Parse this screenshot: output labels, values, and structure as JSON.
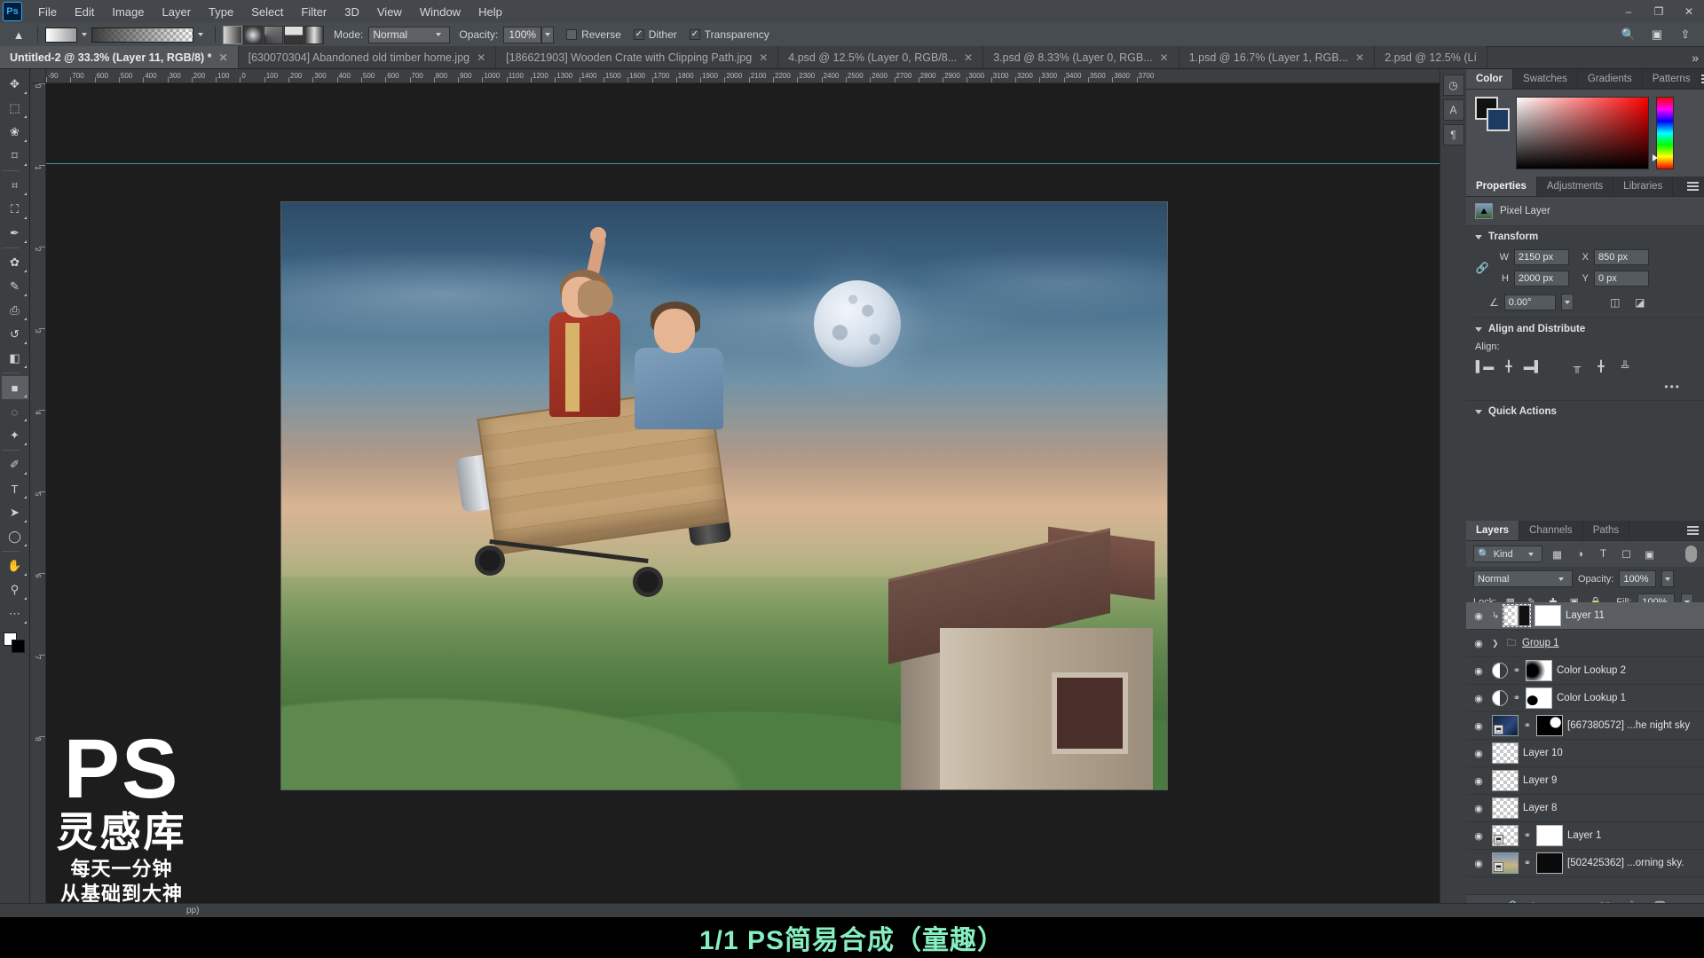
{
  "app": {
    "logo": "Ps"
  },
  "menubar": {
    "items": [
      "File",
      "Edit",
      "Image",
      "Layer",
      "Type",
      "Select",
      "Filter",
      "3D",
      "View",
      "Window",
      "Help"
    ],
    "window_controls": {
      "minimize": "–",
      "maximize": "❐",
      "close": "✕"
    }
  },
  "options_bar": {
    "home_icon": "home-icon",
    "gradient_preset_label": "gradient-preset",
    "gradient_types": [
      "linear-gradient",
      "radial-gradient",
      "angle-gradient",
      "reflected-gradient",
      "diamond-gradient"
    ],
    "mode_label": "Mode:",
    "mode_value": "Normal",
    "opacity_label": "Opacity:",
    "opacity_value": "100%",
    "reverse_label": "Reverse",
    "reverse_checked": false,
    "dither_label": "Dither",
    "dither_checked": true,
    "transparency_label": "Transparency",
    "transparency_checked": true,
    "right_icons": [
      "search-icon",
      "workspace-icon",
      "share-icon"
    ]
  },
  "tabs": [
    {
      "label": "Untitled-2 @ 33.3% (Layer 11, RGB/8) *",
      "active": true,
      "close": "✕"
    },
    {
      "label": "[630070304] Abandoned old timber home.jpg",
      "active": false,
      "close": "✕"
    },
    {
      "label": "[186621903] Wooden Crate with Clipping Path.jpg",
      "active": false,
      "close": "✕"
    },
    {
      "label": "4.psd @ 12.5% (Layer 0, RGB/8...",
      "active": false,
      "close": "✕"
    },
    {
      "label": "3.psd @ 8.33% (Layer 0, RGB...",
      "active": false,
      "close": "✕"
    },
    {
      "label": "1.psd @ 16.7% (Layer 1, RGB...",
      "active": false,
      "close": "✕"
    },
    {
      "label": "2.psd @ 12.5% (Lí",
      "active": false,
      "close": ""
    }
  ],
  "tabs_overflow": "»",
  "toolbar": {
    "tools": [
      {
        "name": "move-tool",
        "glyph": "✥",
        "selected": false
      },
      {
        "name": "rectangular-marquee-tool",
        "glyph": "⬚",
        "selected": false
      },
      {
        "name": "lasso-tool",
        "glyph": "❀",
        "selected": false
      },
      {
        "name": "object-selection-tool",
        "glyph": "⌑",
        "selected": false
      },
      {
        "name": "crop-tool",
        "glyph": "⌗",
        "selected": false
      },
      {
        "name": "frame-tool",
        "glyph": "⛶",
        "selected": false
      },
      {
        "name": "eyedropper-tool",
        "glyph": "✒",
        "selected": false
      },
      {
        "name": "spot-healing-brush-tool",
        "glyph": "✿",
        "selected": false
      },
      {
        "name": "brush-tool",
        "glyph": "✎",
        "selected": false
      },
      {
        "name": "clone-stamp-tool",
        "glyph": "⎙",
        "selected": false
      },
      {
        "name": "history-brush-tool",
        "glyph": "↺",
        "selected": false
      },
      {
        "name": "eraser-tool",
        "glyph": "◧",
        "selected": false
      },
      {
        "name": "gradient-tool",
        "glyph": "■",
        "selected": true
      },
      {
        "name": "blur-tool",
        "glyph": "◌",
        "selected": false
      },
      {
        "name": "dodge-tool",
        "glyph": "✦",
        "selected": false
      },
      {
        "name": "pen-tool",
        "glyph": "✐",
        "selected": false
      },
      {
        "name": "horizontal-type-tool",
        "glyph": "T",
        "selected": false
      },
      {
        "name": "path-selection-tool",
        "glyph": "➤",
        "selected": false
      },
      {
        "name": "ellipse-tool",
        "glyph": "◯",
        "selected": false
      },
      {
        "name": "hand-tool",
        "glyph": "✋",
        "selected": false
      },
      {
        "name": "zoom-tool",
        "glyph": "⚲",
        "selected": false
      },
      {
        "name": "edit-toolbar-button",
        "glyph": "⋯",
        "selected": false
      }
    ],
    "foreground_color": "#ffffff",
    "background_color": "#000000"
  },
  "rulers": {
    "unit": "px",
    "h_ticks": [
      "-90",
      "700",
      "600",
      "500",
      "400",
      "300",
      "200",
      "100",
      "0",
      "100",
      "200",
      "300",
      "400",
      "500",
      "600",
      "700",
      "800",
      "900",
      "1000",
      "1100",
      "1200",
      "1300",
      "1400",
      "1500",
      "1600",
      "1700",
      "1800",
      "1900",
      "2000",
      "2100",
      "2200",
      "2300",
      "2400",
      "2500",
      "2600",
      "2700",
      "2800",
      "2900",
      "3000",
      "3100",
      "3200",
      "3300",
      "3400",
      "3500",
      "3600",
      "3700"
    ],
    "v_ticks": [
      "0",
      "1",
      "2",
      "3",
      "4",
      "5",
      "6",
      "7",
      "8"
    ]
  },
  "color_panel": {
    "tabs": [
      "Color",
      "Swatches",
      "Gradients",
      "Patterns"
    ],
    "active_tab": "Color",
    "foreground": "#111111",
    "background": "#1d3a63"
  },
  "properties_panel": {
    "tabs": [
      "Properties",
      "Adjustments",
      "Libraries"
    ],
    "active_tab": "Properties",
    "layer_type": "Pixel Layer",
    "transform": {
      "title": "Transform",
      "w_label": "W",
      "w_value": "2150 px",
      "h_label": "H",
      "h_value": "2000 px",
      "x_label": "X",
      "x_value": "850 px",
      "y_label": "Y",
      "y_value": "0 px",
      "angle_value": "0.00°",
      "flip_h_icon": "flip-horizontal-icon",
      "flip_v_icon": "flip-vertical-icon"
    },
    "align": {
      "title": "Align and Distribute",
      "label": "Align:",
      "buttons": [
        "align-left-icon",
        "align-center-h-icon",
        "align-right-icon",
        "align-top-icon",
        "align-center-v-icon",
        "align-bottom-icon"
      ],
      "more": "•••"
    },
    "quick_actions": {
      "title": "Quick Actions"
    }
  },
  "layers_panel": {
    "tabs": [
      "Layers",
      "Channels",
      "Paths"
    ],
    "active_tab": "Layers",
    "filter_label": "Kind",
    "filter_icons": [
      "pixel-filter-icon",
      "adjustment-filter-icon",
      "type-filter-icon",
      "shape-filter-icon",
      "smart-object-filter-icon"
    ],
    "blend_mode": "Normal",
    "opacity_label": "Opacity:",
    "opacity_value": "100%",
    "lock_label": "Lock:",
    "lock_icons": [
      "lock-transparent-pixels-icon",
      "lock-image-pixels-icon",
      "lock-position-icon",
      "lock-artboard-icon",
      "lock-all-icon"
    ],
    "fill_label": "Fill:",
    "fill_value": "100%",
    "layers": [
      {
        "name": "Layer 11",
        "selected": true,
        "clipped": true,
        "has_mask": true,
        "kind": "pixel",
        "visible": true
      },
      {
        "name": "Group 1",
        "selected": false,
        "kind": "group",
        "visible": true,
        "underline": true
      },
      {
        "name": "Color Lookup 2",
        "selected": false,
        "kind": "adjustment",
        "has_mask": true,
        "linked": true,
        "visible": true
      },
      {
        "name": "Color Lookup 1",
        "selected": false,
        "kind": "adjustment",
        "has_mask": true,
        "linked": true,
        "visible": true
      },
      {
        "name": "[667380572] ...he night sky",
        "selected": false,
        "kind": "smart",
        "has_mask": true,
        "linked": true,
        "visible": true
      },
      {
        "name": "Layer 10",
        "selected": false,
        "kind": "pixel",
        "visible": true
      },
      {
        "name": "Layer 9",
        "selected": false,
        "kind": "pixel",
        "visible": true
      },
      {
        "name": "Layer 8",
        "selected": false,
        "kind": "pixel",
        "visible": true
      },
      {
        "name": "Layer 1",
        "selected": false,
        "kind": "smart",
        "has_mask": true,
        "linked": true,
        "visible": true
      },
      {
        "name": "[502425362] ...orning sky.",
        "selected": false,
        "kind": "smart",
        "has_mask": true,
        "linked": true,
        "visible": true
      }
    ],
    "footer_icons": [
      "link-layers-icon",
      "add-layer-style-icon",
      "add-layer-mask-icon",
      "new-fill-adjustment-icon",
      "new-group-icon",
      "new-layer-icon",
      "delete-layer-icon"
    ]
  },
  "right_rail": {
    "icons": [
      "history-panel-icon",
      "character-panel-icon",
      "paragraph-panel-icon"
    ]
  },
  "status_bar": {
    "text": "pp)"
  },
  "watermark": {
    "ps": "PS",
    "title": "灵感库",
    "line1": "每天一分钟",
    "line2": "从基础到大神"
  },
  "caption": {
    "text": "1/1 PS简易合成（童趣）",
    "color": "#86efc0"
  }
}
